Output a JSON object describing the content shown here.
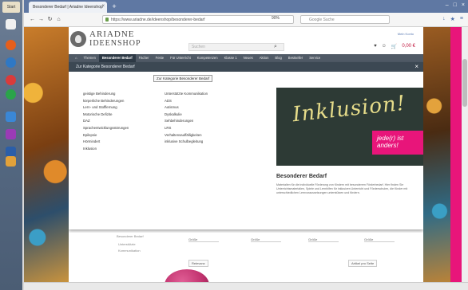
{
  "desktop": {
    "start_label": "Start",
    "rail_icons": [
      "firefox-icon",
      "chrome-icon",
      "skype-icon",
      "folder-icon",
      "app-icon"
    ]
  },
  "browser": {
    "tab_title": "Besonderer Bedarf | Ariadne Ideenshop",
    "url": "https://www.ariadne.de/ideenshop/besonderer-bedarf",
    "zoom": "90%",
    "search_placeholder": "Google Suche",
    "colors": {
      "tabbar": "#5f78a3",
      "accent_pink": "#e8157a"
    }
  },
  "site": {
    "logo_line1": "ARIADNE",
    "logo_line2": "IDEENSHOP",
    "search_placeholder": "Suchen",
    "account_link": "Mein Konto",
    "cart_label": "0,00 €",
    "nav": [
      {
        "label": "Themen",
        "active": false
      },
      {
        "label": "Besonderer Bedarf",
        "active": true
      },
      {
        "label": "Fächer",
        "active": false
      },
      {
        "label": "Feste",
        "active": false
      },
      {
        "label": "Für Unterricht",
        "active": false
      },
      {
        "label": "Kompetenzen",
        "active": false
      },
      {
        "label": "Klasse 1",
        "active": false
      },
      {
        "label": "Neues",
        "active": false
      },
      {
        "label": "Aktion",
        "active": false
      },
      {
        "label": "Blog",
        "active": false
      },
      {
        "label": "Bestseller",
        "active": false
      },
      {
        "label": "Service",
        "active": false
      }
    ],
    "mega": {
      "title": "Zur Kategorie Besonderer Bedarf",
      "all_button": "Zur Kategorie Besonderer Bedarf",
      "col1": [
        "geistige Behinderung",
        "körperliche Behinderungen",
        "Lern- und Stofflernung",
        "Motorische Defizite",
        "DAZ",
        "Sprachentwicklungsstörungen",
        "Epilepsie",
        "Hörmindert",
        "Inklusion"
      ],
      "col2": [
        "Unterstützte Kommunikation",
        "ADS",
        "Autismus",
        "Dyskalkulie",
        "Sehbehinderungen",
        "LRS",
        "Verhaltensauffälligkeiten",
        "inklusive Schulbegleitung"
      ],
      "teaser_word": "Inklusion!",
      "teaser_tag": "jede(r) ist anders!",
      "teaser_title": "Besonderer Bedarf",
      "teaser_text": "Materialien für die individuelle Förderung von Kindern mit besonderem Förderbedarf. Hier finden Sie Unterrichtsmaterialien, Spiele und Lernhilfen für inklusiven Unterricht und Förderschulen, die Kinder mit unterschiedlichen Lernvoraussetzungen unterstützen und fördern."
    },
    "filters": [
      "Größe",
      "Größe",
      "Größe",
      "Größe"
    ],
    "lower_links": [
      "Besonderer Bedarf",
      "Unterstützte",
      "Kommunikation"
    ],
    "sort_label": "Relevanz",
    "per_page_label": "Artikel pro Seite"
  }
}
